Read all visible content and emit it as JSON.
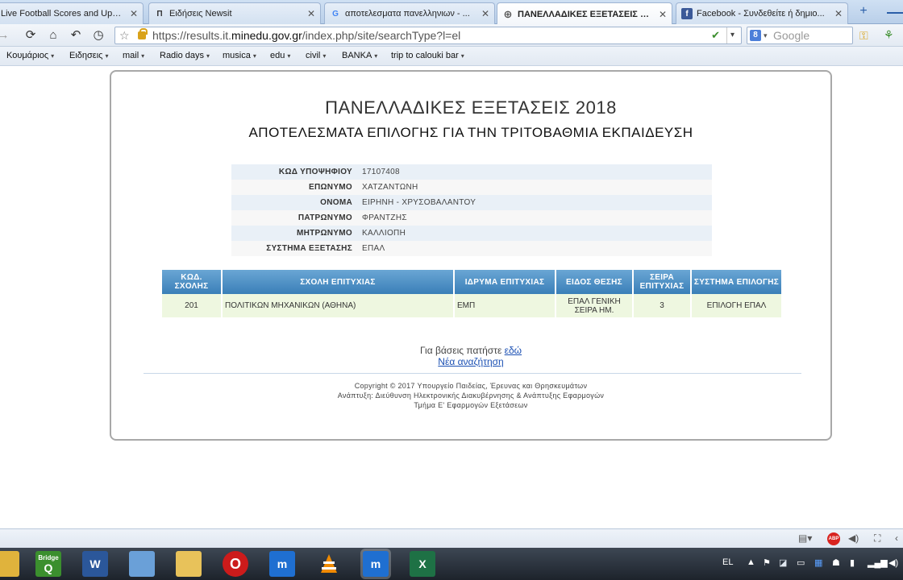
{
  "browser": {
    "tabs": [
      {
        "label": "Live Football Scores and Updat...",
        "favicon": "",
        "color": "#2a7a2a"
      },
      {
        "label": "Ειδήσεις Newsit",
        "favicon": "Π",
        "color": "#333333"
      },
      {
        "label": "αποτελεσματα πανελληνιων - ...",
        "favicon": "G",
        "color": "#4285f4"
      },
      {
        "label": "ΠΑΝΕΛΛΑΔΙΚΕΣ ΕΞΕΤΑΣΕΙΣ 20...",
        "favicon": "⊕",
        "color": "#555555"
      },
      {
        "label": "Facebook - Συνδεθείτε ή δημιο...",
        "favicon": "f",
        "color": "#3b5998"
      }
    ],
    "active_tab": 3,
    "url_prefix": "https://results.it.",
    "url_domain": "minedu.gov.gr",
    "url_path": "/index.php/site/searchType?l=el",
    "search_placeholder": "Google",
    "bookmarks": [
      "Κουμάριος",
      "Ειδησεις",
      "mail",
      "Radio days",
      "musica",
      "edu",
      "civil",
      "BANKA",
      "trip to calouki bar"
    ]
  },
  "page": {
    "title": "ΠΑΝΕΛΛΑΔΙΚΕΣ ΕΞΕΤΑΣΕΙΣ 2018",
    "subtitle": "ΑΠΟΤΕΛΕΣΜΑΤΑ ΕΠΙΛΟΓΗΣ ΓΙΑ ΤΗΝ ΤΡΙΤΟΒΑΘΜΙΑ ΕΚΠΑΙΔΕΥΣΗ",
    "candidate": [
      {
        "label": "ΚΩΔ ΥΠΟΨΗΦΙΟΥ",
        "value": "17107408"
      },
      {
        "label": "ΕΠΩΝΥΜΟ",
        "value": "ΧΑΤΖΑΝΤΩΝΗ"
      },
      {
        "label": "ΟΝΟΜΑ",
        "value": "ΕΙΡΗΝΗ - ΧΡΥΣΟΒΑΛΑΝΤΟΥ"
      },
      {
        "label": "ΠΑΤΡΩΝΥΜΟ",
        "value": "ΦΡΑΝΤΖΗΣ"
      },
      {
        "label": "ΜΗΤΡΩΝΥΜΟ",
        "value": "ΚΑΛΛΙΟΠΗ"
      },
      {
        "label": "ΣΥΣΤΗΜΑ ΕΞΕΤΑΣΗΣ",
        "value": "ΕΠΑΛ"
      }
    ],
    "results_headers": [
      "ΚΩΔ. ΣΧΟΛΗΣ",
      "ΣΧΟΛΗ ΕΠΙΤΥΧΙΑΣ",
      "ΙΔΡΥΜΑ ΕΠΙΤΥΧΙΑΣ",
      "ΕΙΔΟΣ ΘΕΣΗΣ",
      "ΣΕΙΡΑ ΕΠΙΤΥΧΙΑΣ",
      "ΣΥΣΤΗΜΑ ΕΠΙΛΟΓΗΣ"
    ],
    "results_rows": [
      [
        "201",
        "ΠΟΛΙΤΙΚΩΝ ΜΗΧΑΝΙΚΩΝ (ΑΘΗΝΑ)",
        "ΕΜΠ",
        "ΕΠΑΛ ΓΕΝΙΚΗ ΣΕΙΡΑ ΗΜ.",
        "3",
        "ΕΠΙΛΟΓΗ ΕΠΑΛ"
      ]
    ],
    "bases_text": "Για βάσεις πατήστε",
    "bases_link": "εδώ",
    "new_search": "Νέα αναζήτηση",
    "copyright": [
      "Copyright © 2017 Υπουργείο Παιδείας, Έρευνας και Θρησκευμάτων",
      "Ανάπτυξη: Διεύθυνση Ηλεκτρονικής Διακυβέρνησης & Ανάπτυξης Εφαρμογών",
      "Τμήμα Ε' Εφαρμογών Εξετάσεων"
    ]
  },
  "statusbar": {
    "adblock": "ABP"
  },
  "taskbar": {
    "apps": [
      {
        "name": "explorer",
        "label": "",
        "color": "#e0b33c"
      },
      {
        "name": "bridge",
        "label": "Bridge",
        "color": "#3b8f2e"
      },
      {
        "name": "word",
        "label": "W",
        "color": "#2b579a"
      },
      {
        "name": "notes",
        "label": "",
        "color": "#6aa0d8"
      },
      {
        "name": "folder",
        "label": "",
        "color": "#e8c25a"
      },
      {
        "name": "opera",
        "label": "O",
        "color": "#cc1b1b"
      },
      {
        "name": "maxthon",
        "label": "m",
        "color": "#1f6fd1"
      },
      {
        "name": "vlc",
        "label": "",
        "color": "#f08a00"
      },
      {
        "name": "maxthon-active",
        "label": "m",
        "color": "#1f6fd1"
      },
      {
        "name": "excel",
        "label": "X",
        "color": "#1e7145"
      }
    ],
    "language": "EL"
  }
}
